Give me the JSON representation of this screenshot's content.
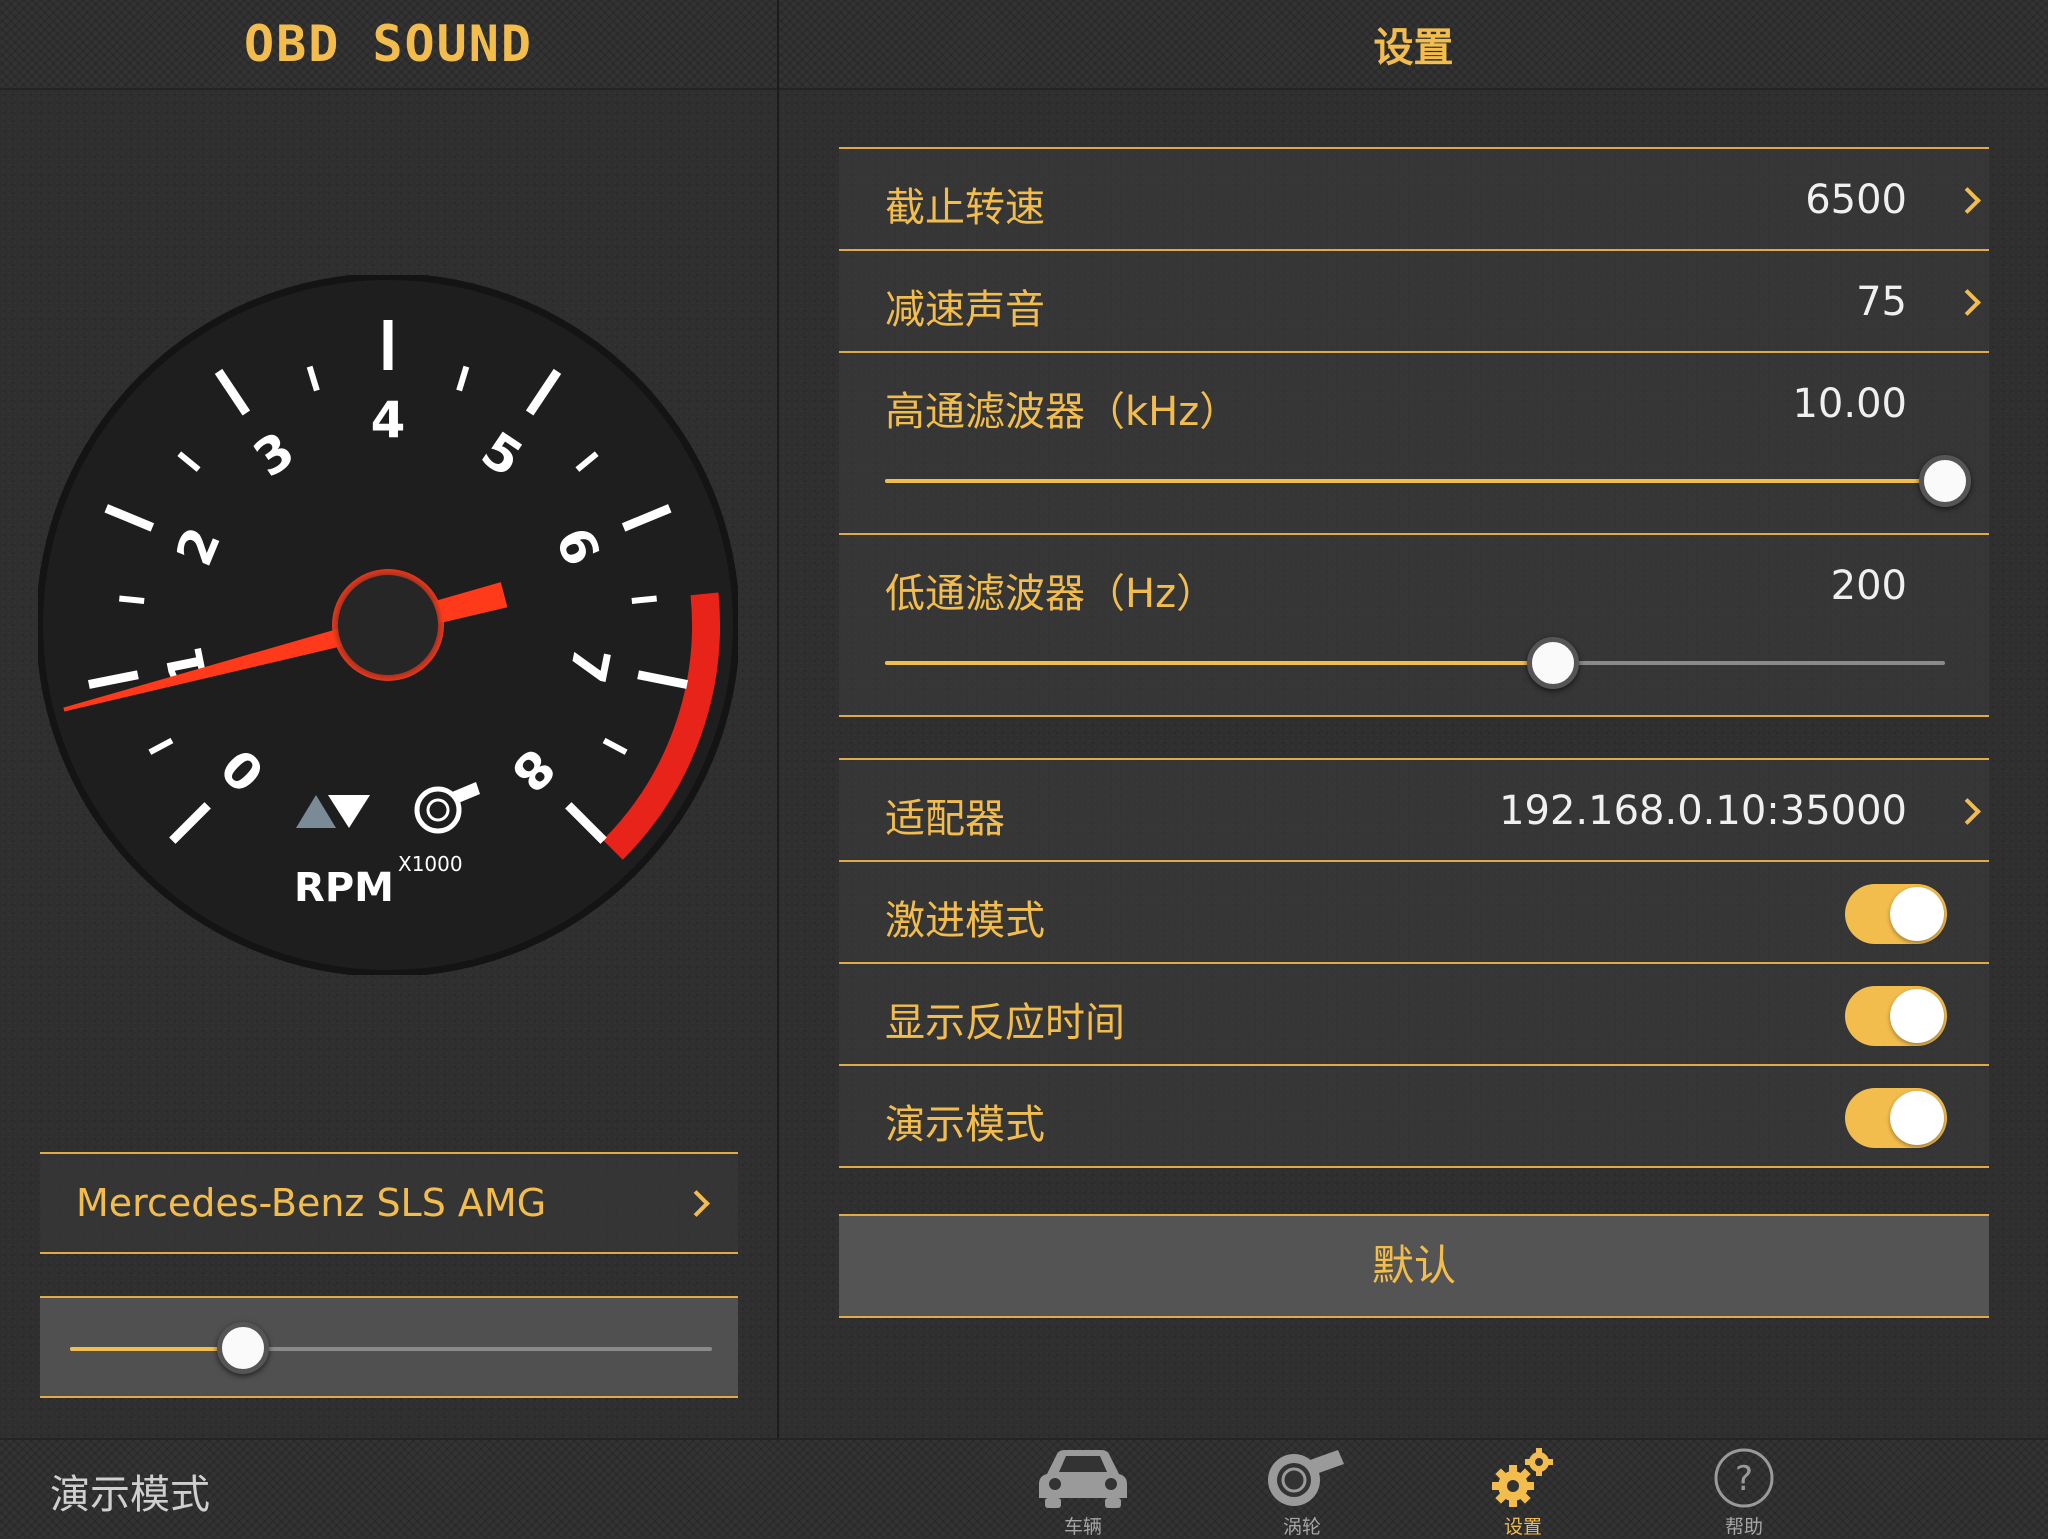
{
  "left": {
    "app_title": "OBD SOUND",
    "gauge": {
      "numbers": [
        "0",
        "1",
        "2",
        "3",
        "4",
        "5",
        "6",
        "7",
        "8"
      ],
      "unit": "RPM",
      "multiplier": "X1000",
      "needle_rpm": 0.9,
      "max_rpm": 8,
      "redline_start_rpm": 6.5
    },
    "car_name": "Mercedes-Benz SLS AMG",
    "throttle_slider": 0.27
  },
  "right": {
    "title": "设置",
    "settings": {
      "cutoff_rpm": {
        "label": "截止转速",
        "value": "6500"
      },
      "decel_sound": {
        "label": "减速声音",
        "value": "75"
      },
      "highpass": {
        "label": "高通滤波器（kHz）",
        "value": "10.00",
        "level": 1.0
      },
      "lowpass": {
        "label": "低通滤波器（Hz）",
        "value": "200",
        "level": 0.63
      }
    },
    "adapter": {
      "label": "适配器",
      "value": "192.168.0.10:35000"
    },
    "toggles": [
      {
        "label": "激进模式",
        "on": true
      },
      {
        "label": "显示反应时间",
        "on": true
      },
      {
        "label": "演示模式",
        "on": true
      }
    ],
    "default_button": "默认"
  },
  "tabbar": {
    "demo_mode_label": "演示模式",
    "tabs": [
      {
        "label": "车辆",
        "icon": "car-icon"
      },
      {
        "label": "涡轮",
        "icon": "turbo-icon"
      },
      {
        "label": "设置",
        "icon": "gears-icon",
        "active": true
      },
      {
        "label": "帮助",
        "icon": "help-icon"
      }
    ]
  },
  "colors": {
    "accent": "#f3bd4e",
    "redline": "#e8231a",
    "needle": "#ff3a1a"
  }
}
